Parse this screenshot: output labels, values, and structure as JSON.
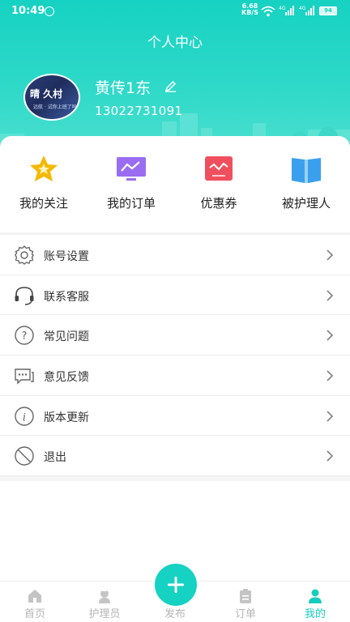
{
  "status_bar": {
    "time": "10:49",
    "net_speed_value": "6.68",
    "net_speed_unit": "KB/S",
    "signal1": "4G",
    "signal2": "4G",
    "battery": "94"
  },
  "header": {
    "title": "个人中心",
    "bg_color": "#16d2c2"
  },
  "profile": {
    "name": "黄传1东",
    "phone": "13022731091",
    "avatar_text": "晴 久村 ",
    "avatar_caption": "远航 · 试你上班了吗"
  },
  "shortcuts": [
    {
      "label": "我的关注",
      "icon": "star-icon"
    },
    {
      "label": "我的订单",
      "icon": "monitor-chart-icon"
    },
    {
      "label": "优惠券",
      "icon": "coupon-icon"
    },
    {
      "label": "被护理人",
      "icon": "book-icon"
    }
  ],
  "menu": [
    {
      "label": "账号设置",
      "icon": "gear-icon"
    },
    {
      "label": "联系客服",
      "icon": "headset-icon"
    },
    {
      "label": "常见问题",
      "icon": "question-icon"
    },
    {
      "label": "意见反馈",
      "icon": "feedback-icon"
    },
    {
      "label": "版本更新",
      "icon": "info-icon"
    },
    {
      "label": "退出",
      "icon": "logout-icon"
    }
  ],
  "tabbar": [
    {
      "label": "首页",
      "icon": "home-icon",
      "active": false
    },
    {
      "label": "护理员",
      "icon": "nurse-icon",
      "active": false
    },
    {
      "label": "发布",
      "icon": "plus-icon",
      "active": false
    },
    {
      "label": "订单",
      "icon": "clipboard-icon",
      "active": false
    },
    {
      "label": "我的",
      "icon": "person-icon",
      "active": true
    }
  ],
  "colors": {
    "accent": "#16cdbd",
    "inactive": "#b5b5b5",
    "coupon": "#f0505e",
    "order": "#9a6cf2",
    "star": "#f5b800",
    "book": "#3aa0ee"
  }
}
